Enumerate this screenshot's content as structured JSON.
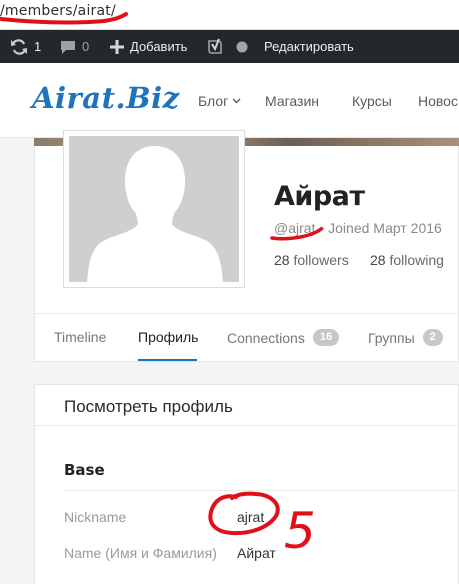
{
  "browser": {
    "url": "/members/airat/"
  },
  "admin_bar": {
    "updates_count": "1",
    "comments_count": "0",
    "add_new": "Добавить",
    "edit": "Редактировать"
  },
  "site": {
    "logo": "Airat.Biz",
    "nav": [
      "Блог",
      "Магазин",
      "Курсы",
      "Новос"
    ]
  },
  "profile": {
    "name": "Айрат",
    "handle": "@ajrat",
    "separator": "•",
    "joined": "Joined Март 2016",
    "followers_count": "28",
    "followers_label": "followers",
    "following_count": "28",
    "following_label": "following"
  },
  "tabs": [
    {
      "label": "Timeline"
    },
    {
      "label": "Профиль"
    },
    {
      "label": "Connections",
      "badge": "16"
    },
    {
      "label": "Группы",
      "badge": "2"
    }
  ],
  "content": {
    "title": "Посмотреть профиль",
    "section": "Base",
    "fields": [
      {
        "label": "Nickname",
        "value": "ajrat"
      },
      {
        "label": "Name (Имя и Фамилия)",
        "value": "Айрат"
      }
    ]
  },
  "annotation": {
    "number": "5",
    "color": "#e0101a"
  },
  "colors": {
    "accent": "#1e73be",
    "admin_bar": "#23282d"
  }
}
